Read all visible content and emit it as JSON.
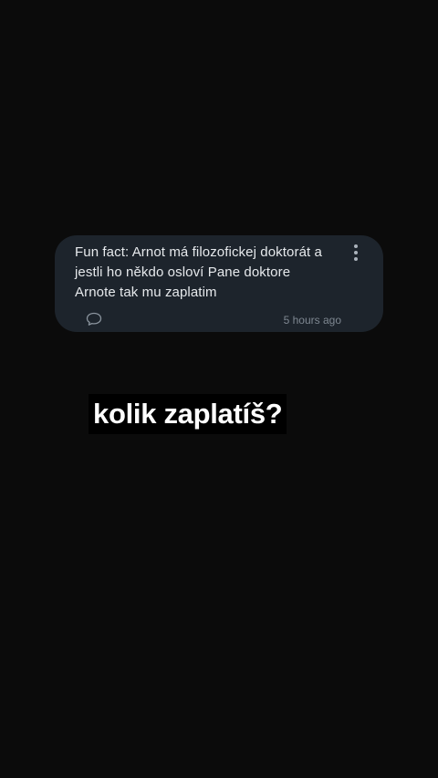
{
  "comment": {
    "text": "Fun fact: Arnot má filozofickej doktorát a jestli ho někdo osloví Pane doktore Arnote tak mu zaplatim",
    "timestamp": "5 hours ago",
    "reply_icon": "speech-bubble-icon",
    "menu_icon": "more-vertical-icon"
  },
  "caption": {
    "text": "kolik zaplatíš?"
  },
  "colors": {
    "background": "#0b0b0b",
    "card": "#1d242c",
    "card_text": "#e6e9ec",
    "timestamp": "#7e8791",
    "caption_bg": "#000000",
    "caption_text": "#ffffff"
  }
}
